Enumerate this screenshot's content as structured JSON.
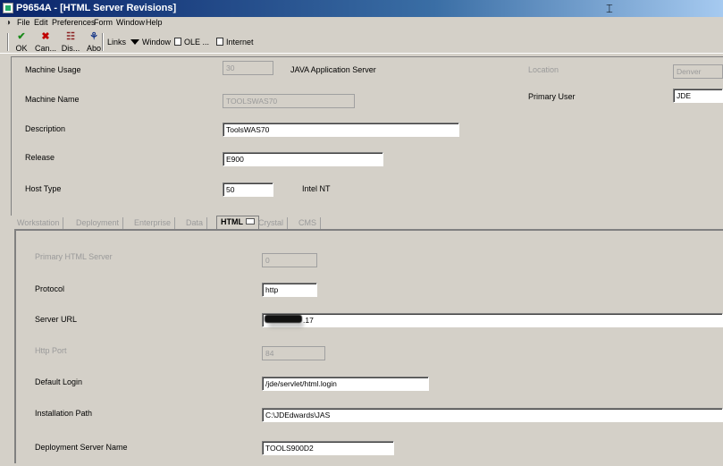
{
  "window": {
    "title": "P9654A - [HTML Server Revisions]"
  },
  "menu": [
    "File",
    "Edit",
    "Preferences",
    "Form",
    "Window",
    "Help"
  ],
  "toolbar": {
    "ok": "OK",
    "cancel": "Can...",
    "delete": "Dis...",
    "about": "Abo",
    "links": "Links",
    "window": "Window",
    "ole": "OLE ...",
    "internet": "Internet"
  },
  "header": {
    "machine_usage": {
      "label": "Machine Usage",
      "value": "30",
      "description": "JAVA Application Server"
    },
    "location": {
      "label": "Location",
      "value": "Denver"
    },
    "machine_name": {
      "label": "Machine Name",
      "value": "TOOLSWAS70"
    },
    "primary_user": {
      "label": "Primary User",
      "value": "JDE"
    },
    "description": {
      "label": "Description",
      "value": "ToolsWAS70"
    },
    "release": {
      "label": "Release",
      "value": "E900"
    },
    "host_type": {
      "label": "Host Type",
      "value": "50",
      "description": "Intel NT"
    }
  },
  "tabs": [
    {
      "label": "Workstation",
      "active": false
    },
    {
      "label": "Deployment",
      "active": false
    },
    {
      "label": "Enterprise",
      "active": false
    },
    {
      "label": "Data",
      "active": false
    },
    {
      "label": "HTML",
      "active": true
    },
    {
      "label": "Crystal",
      "active": false
    },
    {
      "label": "CMS",
      "active": false
    }
  ],
  "html_tab": {
    "primary_html_server": {
      "label": "Primary HTML Server",
      "value": "0"
    },
    "protocol": {
      "label": "Protocol",
      "value": "http"
    },
    "server_url": {
      "label": "Server URL",
      "value_suffix": ".17"
    },
    "http_port": {
      "label": "Http Port",
      "value": "84"
    },
    "default_login": {
      "label": "Default Login",
      "value": "/jde/servlet/html.login"
    },
    "installation_path": {
      "label": "Installation Path",
      "value": "C:\\JDEdwards\\JAS"
    },
    "deployment_server_name": {
      "label": "Deployment Server Name",
      "value": "TOOLS900D2"
    }
  }
}
